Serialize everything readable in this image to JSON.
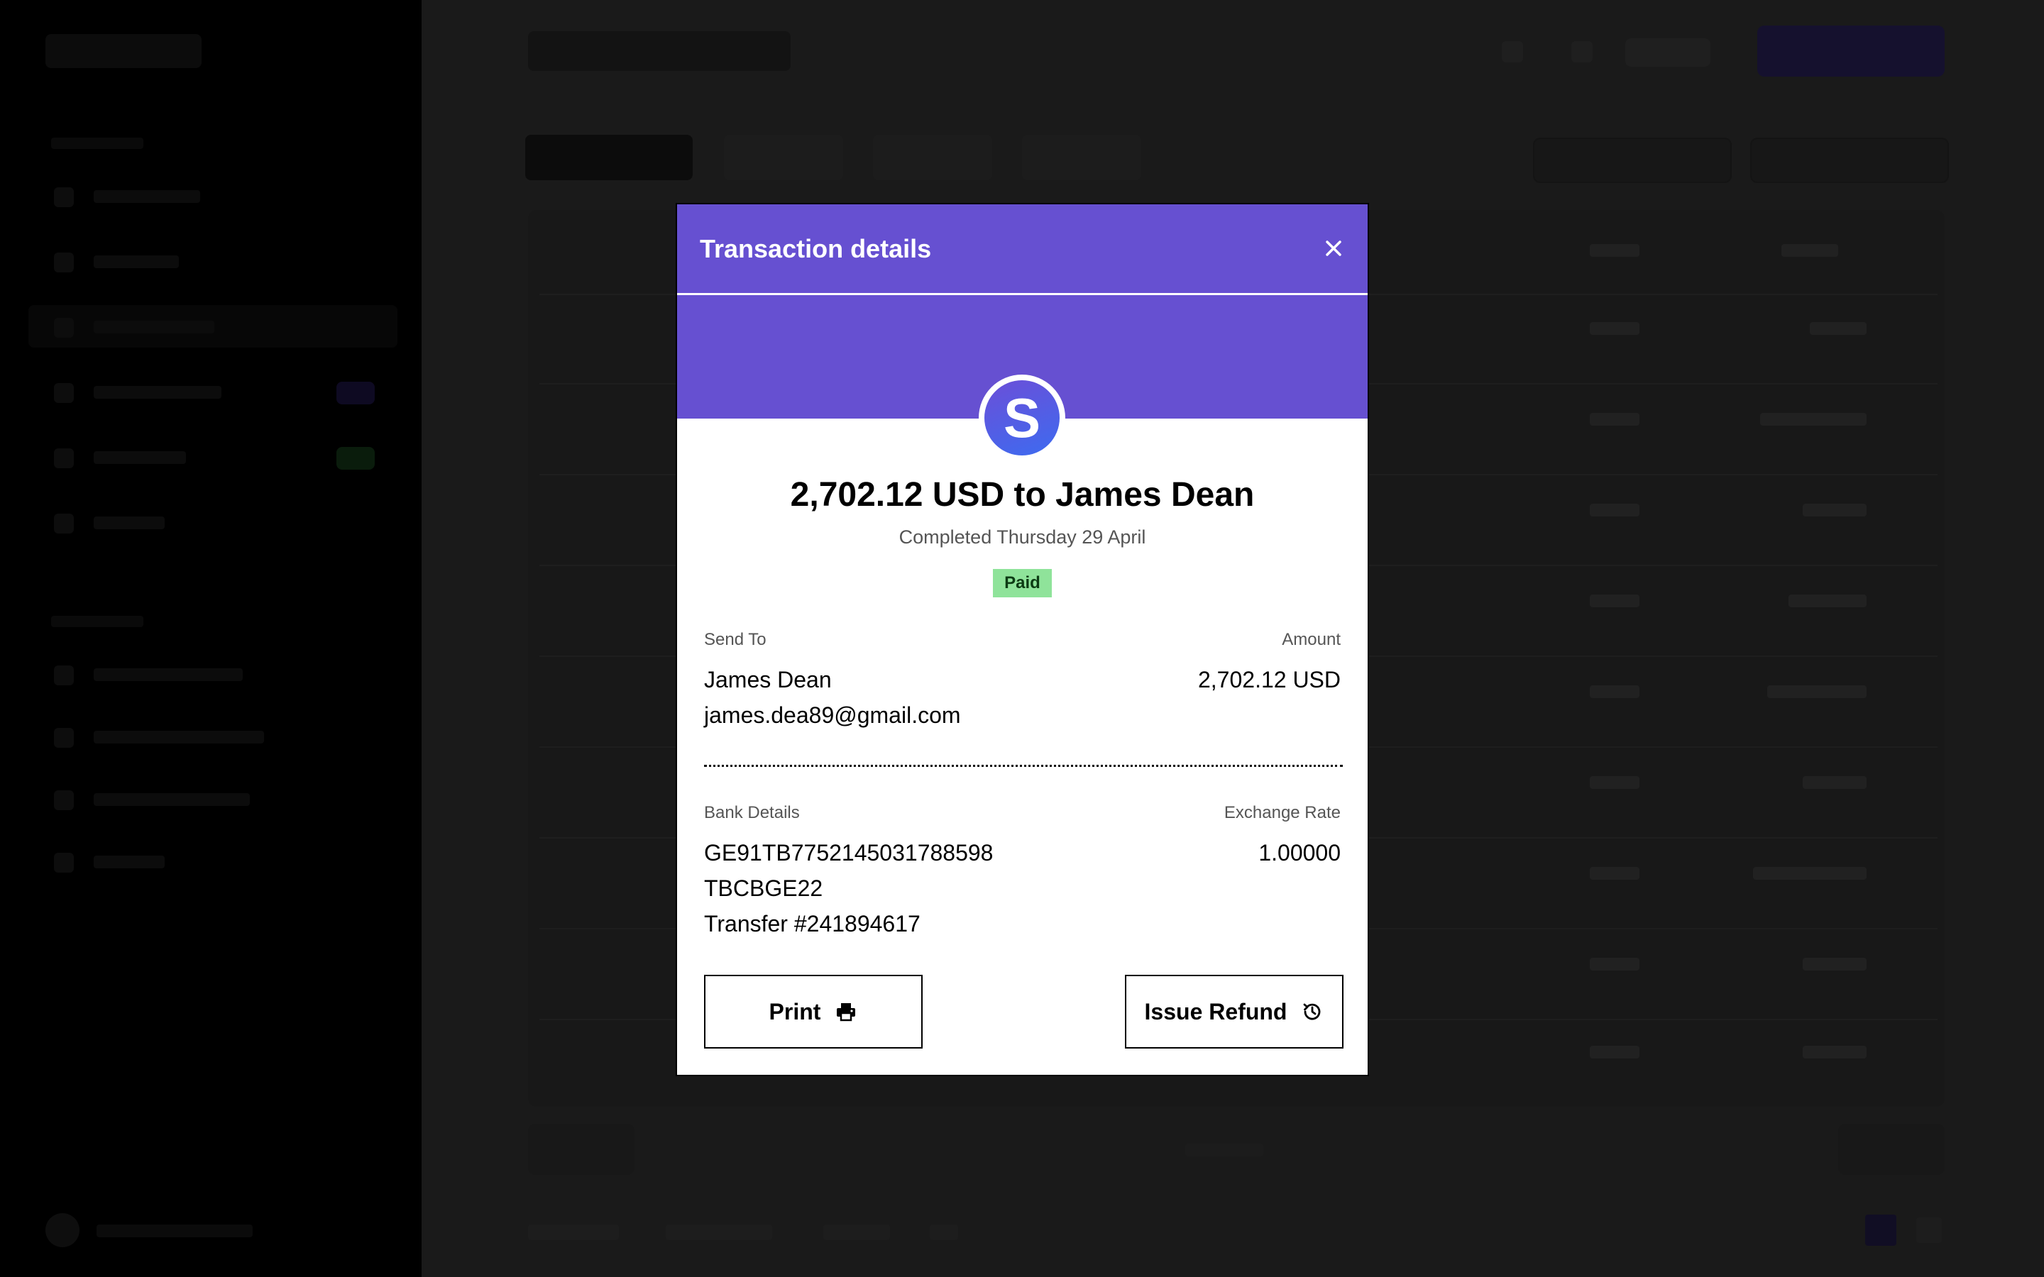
{
  "modal": {
    "title": "Transaction details",
    "avatar_letter": "S",
    "headline": "2,702.12 USD to James Dean",
    "subline": "Completed Thursday 29 April",
    "status_badge": "Paid",
    "send_to_label": "Send To",
    "recipient_name": "James Dean",
    "recipient_email": "james.dea89@gmail.com",
    "amount_label": "Amount",
    "amount_value": "2,702.12 USD",
    "bank_details_label": "Bank Details",
    "iban": "GE91TB7752145031788598",
    "swift": "TBCBGE22",
    "transfer_ref": "Transfer #241894617",
    "exchange_rate_label": "Exchange Rate",
    "exchange_rate_value": "1.00000",
    "print_label": "Print",
    "refund_label": "Issue Refund"
  },
  "icons": {
    "close": "close-icon",
    "print": "printer-icon",
    "refund": "history-icon"
  },
  "colors": {
    "header": "#6650d1",
    "badge_bg": "#8fe39a",
    "badge_text": "#0d3b14"
  }
}
